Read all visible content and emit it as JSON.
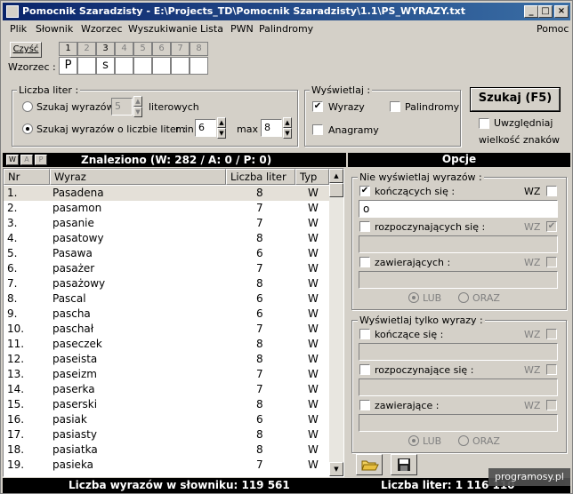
{
  "window": {
    "title": "Pomocnik Szaradzisty - E:\\Projects_TD\\Pomocnik Szaradzisty\\1.1\\PS_WYRAZY.txt"
  },
  "menu": [
    "Plik",
    "Słownik",
    "Wzorzec",
    "Wyszukiwanie",
    "Lista",
    "PWN",
    "Palindromy"
  ],
  "menu_help": "Pomoc",
  "pattern": {
    "clear_label": "Czyść",
    "label": "Wzorzec :",
    "positions": [
      "1",
      "2",
      "3",
      "4",
      "5",
      "6",
      "7",
      "8"
    ],
    "letters": [
      "P",
      "",
      "s",
      "",
      "",
      "",
      "",
      ""
    ]
  },
  "letters_group": {
    "title": "Liczba liter :",
    "opt1_label": "Szukaj wyrazów",
    "opt1_value": "5",
    "opt1_suffix": "literowych",
    "opt2_label": "Szukaj wyrazów o liczbie liter :",
    "min_label": "min",
    "min_value": "6",
    "max_label": "max",
    "max_value": "8"
  },
  "display_group": {
    "title": "Wyświetlaj :",
    "words_label": "Wyrazy",
    "palindromes_label": "Palindromy",
    "anagrams_label": "Anagramy"
  },
  "search_button": "Szukaj (F5)",
  "case_option": {
    "line1": "Uwzględniaj",
    "line2": "wielkość znaków"
  },
  "tabs": [
    "W",
    "A",
    "P"
  ],
  "found_text": "Znaleziono (W: 282 / A: 0 / P: 0)",
  "options_title": "Opcje",
  "table": {
    "headers": [
      "Nr",
      "Wyraz",
      "Liczba liter",
      "Typ"
    ],
    "rows": [
      [
        "1.",
        "Pasadena",
        "8",
        "W"
      ],
      [
        "2.",
        "pasamon",
        "7",
        "W"
      ],
      [
        "3.",
        "pasanie",
        "7",
        "W"
      ],
      [
        "4.",
        "pasatowy",
        "8",
        "W"
      ],
      [
        "5.",
        "Pasawa",
        "6",
        "W"
      ],
      [
        "6.",
        "pasażer",
        "7",
        "W"
      ],
      [
        "7.",
        "pasażowy",
        "8",
        "W"
      ],
      [
        "8.",
        "Pascal",
        "6",
        "W"
      ],
      [
        "9.",
        "pascha",
        "6",
        "W"
      ],
      [
        "10.",
        "paschał",
        "7",
        "W"
      ],
      [
        "11.",
        "paseczek",
        "8",
        "W"
      ],
      [
        "12.",
        "paseista",
        "8",
        "W"
      ],
      [
        "13.",
        "paseizm",
        "7",
        "W"
      ],
      [
        "14.",
        "paserka",
        "7",
        "W"
      ],
      [
        "15.",
        "paserski",
        "8",
        "W"
      ],
      [
        "16.",
        "pasiak",
        "6",
        "W"
      ],
      [
        "17.",
        "pasiasty",
        "8",
        "W"
      ],
      [
        "18.",
        "pasiatka",
        "8",
        "W"
      ],
      [
        "19.",
        "pasieka",
        "7",
        "W"
      ]
    ]
  },
  "filter_exclude": {
    "title": "Nie wyświetlaj wyrazów :",
    "ending_label": "kończących się :",
    "ending_value": "o",
    "starting_label": "rozpoczynających się :",
    "containing_label": "zawierających :",
    "wz": "WZ",
    "lub": "LUB",
    "oraz": "ORAZ"
  },
  "filter_only": {
    "title": "Wyświetlaj tylko wyrazy :",
    "ending_label": "kończące się :",
    "starting_label": "rozpoczynające się :",
    "containing_label": "zawierające :",
    "wz": "WZ",
    "lub": "LUB",
    "oraz": "ORAZ"
  },
  "status": {
    "dict_count": "Liczba wyrazów w słowniku: 119 561",
    "letter_count": "Liczba liter: 1 116 110"
  },
  "watermark": "programosy.pl"
}
